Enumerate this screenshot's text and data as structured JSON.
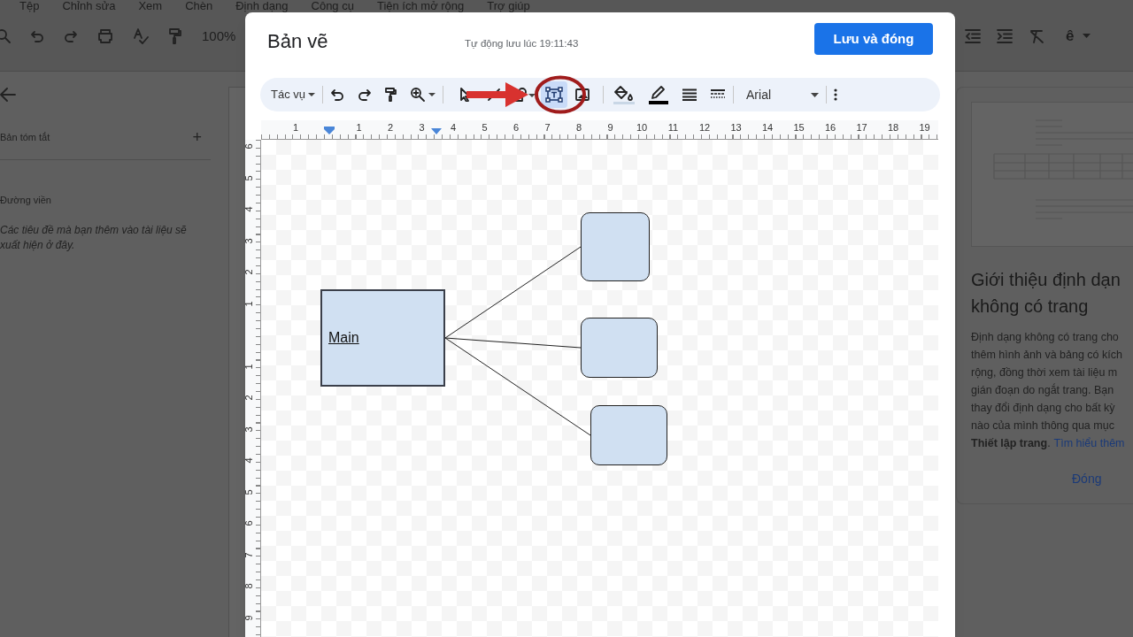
{
  "document": {
    "menu": [
      "Tệp",
      "Chỉnh sửa",
      "Xem",
      "Chèn",
      "Định dạng",
      "Công cụ",
      "Tiện ích mở rộng",
      "Trợ giúp"
    ],
    "toolbar": {
      "zoom": "100%",
      "input_tool": "ê"
    },
    "sidebar": {
      "summary_label": "Bản tóm tắt",
      "add_symbol": "+",
      "outline_label": "Đường viền",
      "outline_hint": "Các tiêu đề mà bạn thêm vào tài liệu sẽ xuất hiện ở đây."
    },
    "promo_panel": {
      "title_lines": [
        "Giới thiệu định dạn",
        "không có trang"
      ],
      "body_lines": [
        "Định dạng không có trang cho",
        "thêm hình ảnh và bảng có kích",
        "rộng, đồng thời xem tài liệu m",
        "gián đoạn do ngắt trang. Bạn",
        "thay đổi định dạng cho bất kỳ",
        "nào của mình thông qua mục"
      ],
      "last_line": "**Thiết lập trang**.",
      "link": "Tìm hiểu thêm",
      "close_button": "Đóng"
    }
  },
  "dialog": {
    "title": "Bản vẽ",
    "autosave": "Tự động lưu lúc 19:11:43",
    "save_button": "Lưu và đóng",
    "toolbar": {
      "actions_menu": "Tác vụ",
      "font": "Arial",
      "tools": [
        {
          "kind": "select",
          "selected": false
        },
        {
          "kind": "line",
          "selected": false
        },
        {
          "kind": "shape",
          "selected": false
        },
        {
          "kind": "textbox",
          "selected": true
        },
        {
          "kind": "image",
          "selected": false
        }
      ]
    },
    "ruler": {
      "horizontal": [
        "1",
        "1",
        "2",
        "3",
        "4",
        "5",
        "6",
        "7",
        "8",
        "9",
        "10",
        "11",
        "12",
        "13",
        "14",
        "15",
        "16",
        "17",
        "18",
        "19"
      ],
      "vertical": [
        "6",
        "5",
        "4",
        "3",
        "2",
        "1",
        "1",
        "2",
        "3",
        "4",
        "5",
        "6",
        "7",
        "8",
        "9"
      ]
    },
    "diagram": {
      "root": {
        "kind": "rect",
        "text": "Main",
        "children": [
          {
            "kind": "rounded"
          },
          {
            "kind": "rounded"
          },
          {
            "kind": "rounded"
          }
        ]
      }
    }
  }
}
